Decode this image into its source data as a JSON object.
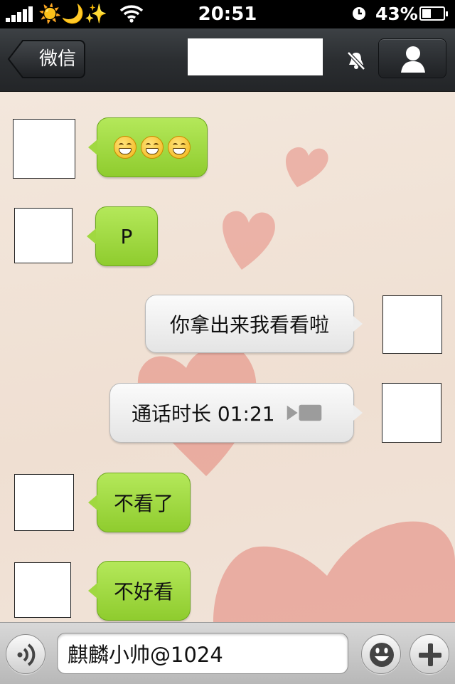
{
  "status_bar": {
    "emoji_icons": "☀️🌙✨",
    "time": "20:51",
    "battery_percent": "43%",
    "signal_level": 5,
    "battery_fraction": 0.43
  },
  "nav_bar": {
    "back_label": "微信",
    "icons": [
      "back-chevron-icon",
      "mute-bell-icon",
      "profile-icon"
    ]
  },
  "messages": [
    {
      "side": "left",
      "type": "emoji",
      "emoji_name": "grinning-face-icon",
      "count": 3
    },
    {
      "side": "left",
      "type": "text",
      "text": "P"
    },
    {
      "side": "right",
      "type": "text",
      "text": "你拿出来我看看啦"
    },
    {
      "side": "right",
      "type": "call",
      "text": "通话时长 01:21",
      "icon": "video-call-icon"
    },
    {
      "side": "left",
      "type": "text",
      "text": "不看了"
    },
    {
      "side": "left",
      "type": "text",
      "text": "不好看"
    }
  ],
  "input_bar": {
    "voice_icon": "voice-input-icon",
    "value": "麒麟小帅@1024",
    "smiley_icon": "smiley-icon",
    "plus_icon": "plus-icon"
  },
  "colors": {
    "green_bubble": "#9fd43f",
    "gray_bubble": "#eeeeee",
    "chat_background": "#f1e3d8",
    "navbar": "#2b2e31",
    "heart": "#e58b7f"
  }
}
